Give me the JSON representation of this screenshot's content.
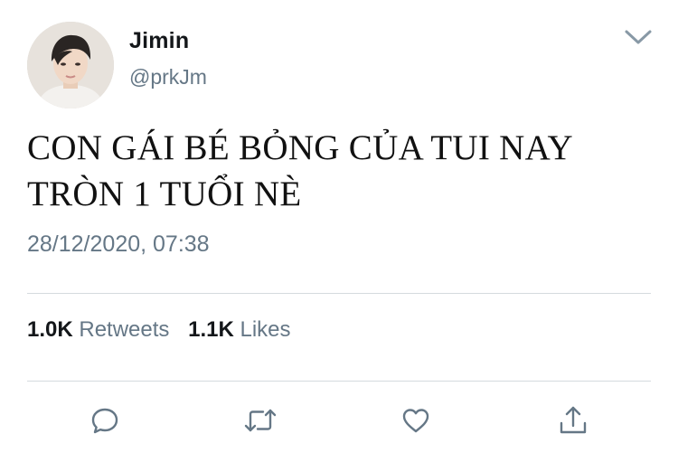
{
  "user": {
    "display_name": "Jimin",
    "handle": "@prkJm"
  },
  "tweet": {
    "text_line1": "CON GÁI BÉ BỎNG CỦA TUI NAY",
    "text_line2": "TRÒN 1 TUỔI NÈ",
    "timestamp": "28/12/2020, 07:38"
  },
  "stats": {
    "retweets_count": "1.0K",
    "retweets_label": "Retweets",
    "likes_count": "1.1K",
    "likes_label": "Likes"
  },
  "icons": {
    "menu": "chevron-down-icon",
    "reply": "reply-icon",
    "retweet": "retweet-icon",
    "like": "heart-icon",
    "share": "share-icon"
  },
  "colors": {
    "primary_text": "#14171a",
    "secondary_text": "#657786",
    "divider": "#d5dade",
    "icon": "#657786"
  }
}
